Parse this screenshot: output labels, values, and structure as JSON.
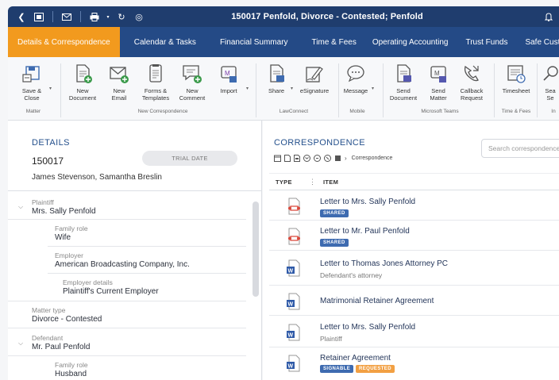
{
  "window": {
    "title": "150017 Penfold, Divorce - Contested; Penfold"
  },
  "nav": {
    "tabs": [
      {
        "label": "Details & Correspondence"
      },
      {
        "label": "Calendar & Tasks"
      },
      {
        "label": "Financial Summary"
      },
      {
        "label": "Time & Fees"
      },
      {
        "label": "Operating Accounting"
      },
      {
        "label": "Trust Funds"
      },
      {
        "label": "Safe Custo"
      }
    ]
  },
  "ribbon": {
    "buttons": [
      {
        "label": "Save &\nClose",
        "icon": "save-close-icon"
      },
      {
        "label": "New\nDocument",
        "icon": "new-document-icon"
      },
      {
        "label": "New\nEmail",
        "icon": "new-email-icon"
      },
      {
        "label": "Forms &\nTemplates",
        "icon": "forms-templates-icon"
      },
      {
        "label": "New\nComment",
        "icon": "new-comment-icon"
      },
      {
        "label": "Import",
        "icon": "import-icon"
      },
      {
        "label": "Share",
        "icon": "share-icon"
      },
      {
        "label": "eSignature",
        "icon": "esignature-icon"
      },
      {
        "label": "Message",
        "icon": "message-icon"
      },
      {
        "label": "Send\nDocument",
        "icon": "send-document-icon"
      },
      {
        "label": "Send\nMatter",
        "icon": "send-matter-icon"
      },
      {
        "label": "Callback\nRequest",
        "icon": "callback-request-icon"
      },
      {
        "label": "Timesheet",
        "icon": "timesheet-icon"
      },
      {
        "label": "Sea\nSe",
        "icon": "search-icon"
      }
    ],
    "groups": [
      {
        "label": "Matter"
      },
      {
        "label": "New Correspondence"
      },
      {
        "label": "LawConnect"
      },
      {
        "label": "Mobile"
      },
      {
        "label": "Microsoft Teams"
      },
      {
        "label": "Time & Fees"
      },
      {
        "label": "In"
      }
    ]
  },
  "details": {
    "title": "DETAILS",
    "matter_number": "150017",
    "trial_date_label": "TRIAL DATE",
    "parties": "James Stevenson, Samantha Breslin",
    "fields": {
      "plaintiff_label": "Plaintiff",
      "plaintiff_value": "Mrs. Sally Penfold",
      "family_role_label": "Family role",
      "family_role_value": "Wife",
      "employer_label": "Employer",
      "employer_value": "American Broadcasting Company, Inc.",
      "employer_details_label": "Employer details",
      "employer_details_value": "Plaintiff's Current Employer",
      "matter_type_label": "Matter type",
      "matter_type_value": "Divorce - Contested",
      "defendant_label": "Defendant",
      "defendant_value": "Mr. Paul Penfold",
      "family_role2_label": "Family role",
      "family_role2_value": "Husband"
    }
  },
  "correspondence": {
    "title": "CORRESPONDENCE",
    "search_placeholder": "Search correspondence",
    "breadcrumb": "Correspondence",
    "columns": {
      "type": "TYPE",
      "item": "ITEM"
    },
    "rows": [
      {
        "title": "Letter to Mrs. Sally Penfold",
        "subtitle": "",
        "badges": [
          "SHARED"
        ],
        "type": "pdf"
      },
      {
        "title": "Letter to Mr. Paul Penfold",
        "subtitle": "",
        "badges": [
          "SHARED"
        ],
        "type": "pdf"
      },
      {
        "title": "Letter to Thomas Jones Attorney PC",
        "subtitle": "Defendant's attorney",
        "badges": [],
        "type": "word"
      },
      {
        "title": "Matrimonial Retainer Agreement",
        "subtitle": "",
        "badges": [],
        "type": "word"
      },
      {
        "title": "Letter to Mrs. Sally Penfold",
        "subtitle": "Plaintiff",
        "badges": [],
        "type": "word"
      },
      {
        "title": "Retainer Agreement",
        "subtitle": "",
        "badges": [
          "SIGNABLE",
          "REQUESTED"
        ],
        "type": "word"
      }
    ]
  },
  "colors": {
    "titlebar": "#1f3d6e",
    "navbar": "#244a86",
    "active_tab": "#f29a1e",
    "accent_text": "#24508c",
    "badge_blue": "#3e6bb0",
    "badge_orange": "#f2a043"
  }
}
